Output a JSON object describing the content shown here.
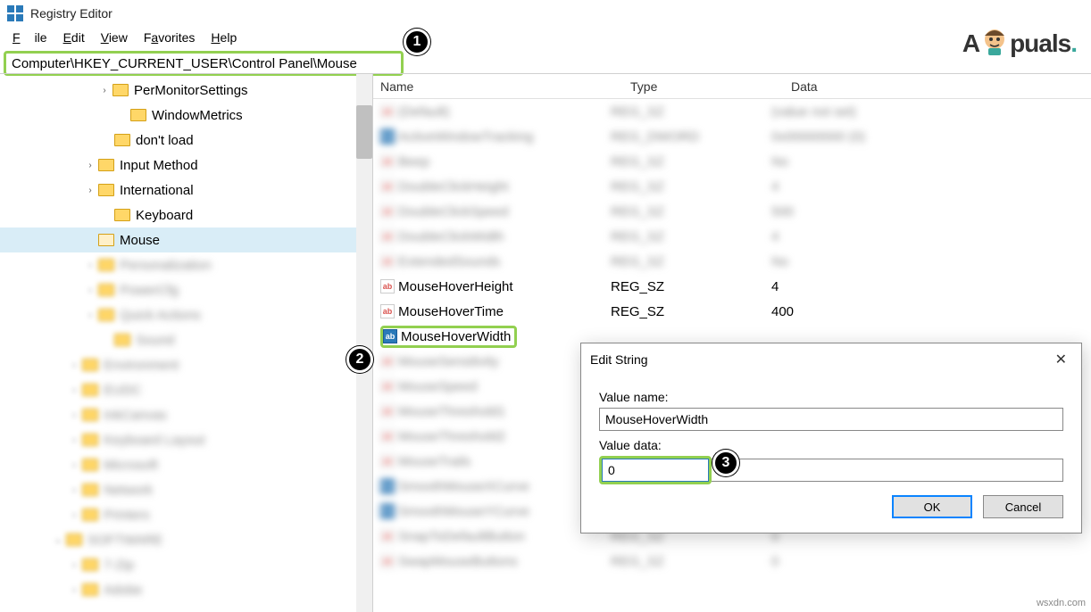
{
  "titlebar": {
    "title": "Registry Editor"
  },
  "menubar": {
    "file": "File",
    "edit": "Edit",
    "view": "View",
    "favorites": "Favorites",
    "help": "Help"
  },
  "addressbar": {
    "path": "Computer\\HKEY_CURRENT_USER\\Control Panel\\Mouse"
  },
  "tree": {
    "items": [
      {
        "label": "PerMonitorSettings",
        "indent": 110,
        "expander": "›",
        "blur": false
      },
      {
        "label": "WindowMetrics",
        "indent": 130,
        "expander": "",
        "blur": false
      },
      {
        "label": "don't load",
        "indent": 112,
        "expander": "",
        "blur": false
      },
      {
        "label": "Input Method",
        "indent": 94,
        "expander": "›",
        "blur": false
      },
      {
        "label": "International",
        "indent": 94,
        "expander": "›",
        "blur": false
      },
      {
        "label": "Keyboard",
        "indent": 112,
        "expander": "",
        "blur": false
      },
      {
        "label": "Mouse",
        "indent": 94,
        "expander": "",
        "blur": false,
        "selected": true,
        "open": true
      },
      {
        "label": "Personalization",
        "indent": 94,
        "expander": "›",
        "blur": true
      },
      {
        "label": "PowerCfg",
        "indent": 94,
        "expander": "›",
        "blur": true
      },
      {
        "label": "Quick Actions",
        "indent": 94,
        "expander": "›",
        "blur": true
      },
      {
        "label": "Sound",
        "indent": 112,
        "expander": "",
        "blur": true
      },
      {
        "label": "Environment",
        "indent": 76,
        "expander": "›",
        "blur": true
      },
      {
        "label": "EUDC",
        "indent": 76,
        "expander": "›",
        "blur": true
      },
      {
        "label": "InkCanvas",
        "indent": 76,
        "expander": "›",
        "blur": true
      },
      {
        "label": "Keyboard Layout",
        "indent": 76,
        "expander": "›",
        "blur": true
      },
      {
        "label": "Microsoft",
        "indent": 76,
        "expander": "›",
        "blur": true
      },
      {
        "label": "Network",
        "indent": 76,
        "expander": "›",
        "blur": true
      },
      {
        "label": "Printers",
        "indent": 76,
        "expander": "›",
        "blur": true
      },
      {
        "label": "SOFTWARE",
        "indent": 58,
        "expander": "⌄",
        "blur": true
      },
      {
        "label": "7-Zip",
        "indent": 76,
        "expander": "›",
        "blur": true
      },
      {
        "label": "Adobe",
        "indent": 76,
        "expander": "›",
        "blur": true
      }
    ]
  },
  "list": {
    "headers": {
      "name": "Name",
      "type": "Type",
      "data": "Data"
    },
    "rows": [
      {
        "icon": "str",
        "name": "(Default)",
        "type": "REG_SZ",
        "data": "(value not set)",
        "blur": true
      },
      {
        "icon": "bin",
        "name": "ActiveWindowTracking",
        "type": "REG_DWORD",
        "data": "0x00000000 (0)",
        "blur": true
      },
      {
        "icon": "str",
        "name": "Beep",
        "type": "REG_SZ",
        "data": "No",
        "blur": true
      },
      {
        "icon": "str",
        "name": "DoubleClickHeight",
        "type": "REG_SZ",
        "data": "4",
        "blur": true
      },
      {
        "icon": "str",
        "name": "DoubleClickSpeed",
        "type": "REG_SZ",
        "data": "500",
        "blur": true
      },
      {
        "icon": "str",
        "name": "DoubleClickWidth",
        "type": "REG_SZ",
        "data": "4",
        "blur": true
      },
      {
        "icon": "str",
        "name": "ExtendedSounds",
        "type": "REG_SZ",
        "data": "No",
        "blur": true
      },
      {
        "icon": "str",
        "name": "MouseHoverHeight",
        "type": "REG_SZ",
        "data": "4",
        "blur": false
      },
      {
        "icon": "str",
        "name": "MouseHoverTime",
        "type": "REG_SZ",
        "data": "400",
        "blur": false
      },
      {
        "icon": "str",
        "name": "MouseHoverWidth",
        "type": "",
        "data": "",
        "blur": false,
        "hl": true
      },
      {
        "icon": "str",
        "name": "MouseSensitivity",
        "type": "",
        "data": "",
        "blur": true
      },
      {
        "icon": "str",
        "name": "MouseSpeed",
        "type": "",
        "data": "",
        "blur": true
      },
      {
        "icon": "str",
        "name": "MouseThreshold1",
        "type": "",
        "data": "",
        "blur": true
      },
      {
        "icon": "str",
        "name": "MouseThreshold2",
        "type": "",
        "data": "",
        "blur": true
      },
      {
        "icon": "str",
        "name": "MouseTrails",
        "type": "",
        "data": "",
        "blur": true
      },
      {
        "icon": "bin",
        "name": "SmoothMouseXCurve",
        "type": "",
        "data": "",
        "blur": true
      },
      {
        "icon": "bin",
        "name": "SmoothMouseYCurve",
        "type": "",
        "data": "",
        "blur": true
      },
      {
        "icon": "str",
        "name": "SnapToDefaultButton",
        "type": "REG_SZ",
        "data": "0",
        "blur": true
      },
      {
        "icon": "str",
        "name": "SwapMouseButtons",
        "type": "REG_SZ",
        "data": "0",
        "blur": true
      }
    ]
  },
  "dialog": {
    "title": "Edit String",
    "valueNameLabel": "Value name:",
    "valueName": "MouseHoverWidth",
    "valueDataLabel": "Value data:",
    "valueData": "0",
    "ok": "OK",
    "cancel": "Cancel"
  },
  "steps": {
    "1": "1",
    "2": "2",
    "3": "3"
  },
  "logo": {
    "text_a": "A",
    "text_p": "puals",
    "dot": "."
  },
  "watermark": "wsxdn.com"
}
